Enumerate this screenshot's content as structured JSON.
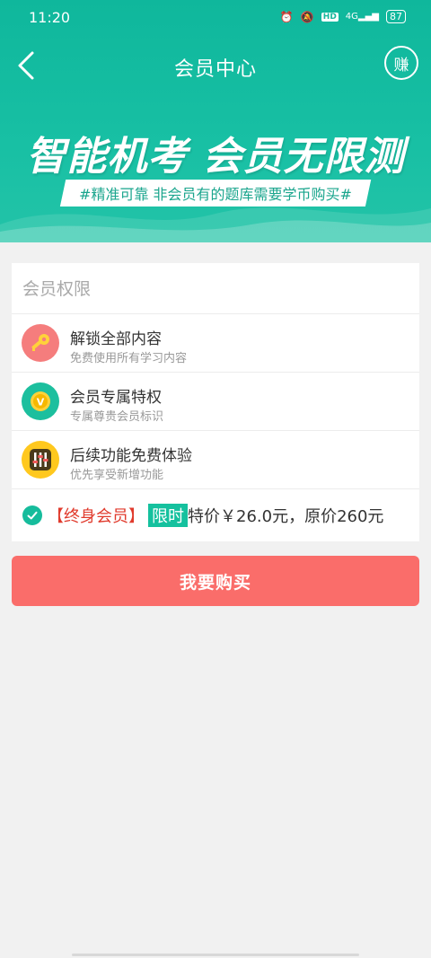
{
  "status": {
    "time": "11:20",
    "hd": "HD",
    "signal": "4G",
    "battery": "87"
  },
  "nav": {
    "title": "会员中心",
    "earn_label": "赚"
  },
  "banner": {
    "title": "智能机考 会员无限测",
    "subtitle": "#精准可靠  非会员有的题库需要学币购买#"
  },
  "benefits": {
    "section_title": "会员权限",
    "items": [
      {
        "title": "解锁全部内容",
        "desc": "免费使用所有学习内容",
        "icon": "key-icon",
        "color": "#f57d7d"
      },
      {
        "title": "会员专属特权",
        "desc": "专属尊贵会员标识",
        "icon": "vip-coin-icon",
        "color": "#1cbf9e"
      },
      {
        "title": "后续功能免费体验",
        "desc": "优先享受新增功能",
        "icon": "sliders-icon",
        "color": "#ffc81e"
      }
    ]
  },
  "offer": {
    "plan": "【终身会员】",
    "tag": "限时",
    "price_text": "特价￥26.0元，原价260元"
  },
  "buy_button_label": "我要购买"
}
